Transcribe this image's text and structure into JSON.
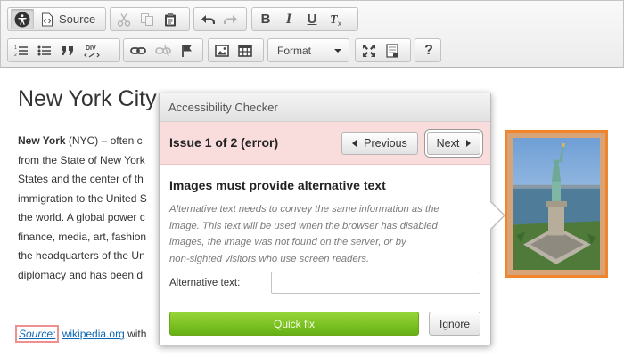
{
  "toolbar": {
    "source_label": "Source",
    "format_label": "Format",
    "help_label": "?"
  },
  "document": {
    "heading": "New York City",
    "paragraph_lines": [
      {
        "bold": "New York",
        "rest": " (NYC) – often c"
      },
      {
        "bold": "",
        "rest": "from the State of New York"
      },
      {
        "bold": "",
        "rest": "States and the center of th"
      },
      {
        "bold": "",
        "rest": "immigration to the United S"
      },
      {
        "bold": "",
        "rest": "the world. A global power c"
      },
      {
        "bold": "",
        "rest": "finance, media, art, fashion"
      },
      {
        "bold": "",
        "rest": "the headquarters of the Un"
      },
      {
        "bold": "",
        "rest": "diplomacy and has been d"
      }
    ],
    "source_label": "Source:",
    "source_link": "wikipedia.org",
    "source_tail": "with"
  },
  "checker": {
    "title": "Accessibility Checker",
    "issue_label": "Issue 1 of 2 (error)",
    "previous_label": "Previous",
    "next_label": "Next",
    "rule_title": "Images must provide alternative text",
    "rule_description_lines": [
      "Alternative text needs to convey the same information as the",
      "image. This text will be used when the browser has disabled",
      "images, the image was not found on the server, or by",
      "non-sighted visitors who use screen readers."
    ],
    "alt_text_label": "Alternative text:",
    "alt_text_value": "",
    "quick_fix_label": "Quick fix",
    "ignore_label": "Ignore"
  },
  "colors": {
    "issue_highlight": "#f0852d",
    "error_bar": "#f9dddd",
    "quick_fix": "#7cc124",
    "link": "#0e66b8"
  }
}
